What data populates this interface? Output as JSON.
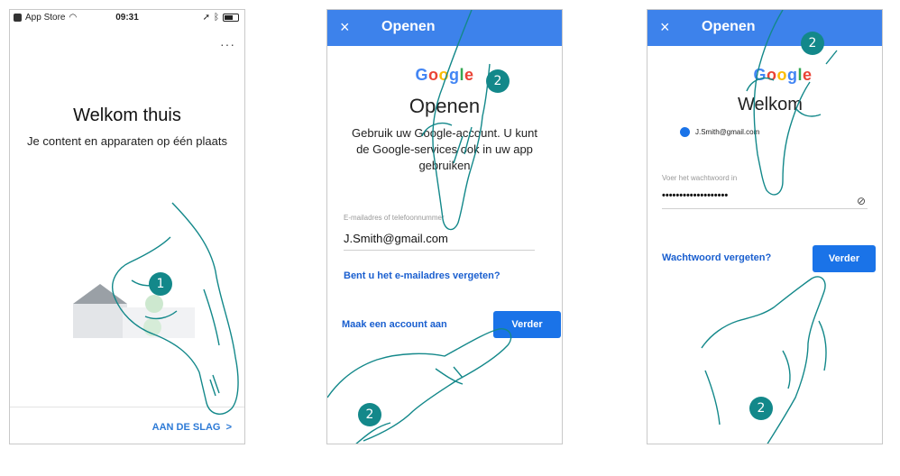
{
  "screen1": {
    "status": {
      "carrier": "App Store",
      "time": "09:31"
    },
    "title": "Welkom thuis",
    "subtitle": "Je content en apparaten op één plaats",
    "start_button": "AAN DE SLAG",
    "step_badge": "1"
  },
  "screen2": {
    "appbar": {
      "close_icon": "×",
      "title": "Openen"
    },
    "logo": [
      "G",
      "o",
      "o",
      "g",
      "l",
      "e"
    ],
    "heading": "Openen",
    "description": "Gebruik uw Google-account. U kunt de Google-services ook in uw app gebruiken",
    "email_label": "E-mailadres of telefoonnummer",
    "email_value": "J.Smith@gmail.com",
    "forgot_email": "Bent u het e-mailadres vergeten?",
    "create_account": "Maak een account aan",
    "next_button": "Verder",
    "step_badges": [
      "2",
      "2"
    ]
  },
  "screen3": {
    "appbar": {
      "close_icon": "×",
      "title": "Openen"
    },
    "logo": [
      "G",
      "o",
      "o",
      "g",
      "l",
      "e"
    ],
    "heading": "Welkom",
    "account": "J.Smith@gmail.com",
    "password_label": "Voer het wachtwoord in",
    "password_value": "•••••••••••••••••••",
    "forgot_password": "Wachtwoord vergeten?",
    "next_button": "Verder",
    "step_badges": [
      "2",
      "2"
    ]
  },
  "colors": {
    "accent": "#3d82eb",
    "button": "#1a73e8",
    "badge": "#13888a",
    "link": "#1a5fcf"
  }
}
